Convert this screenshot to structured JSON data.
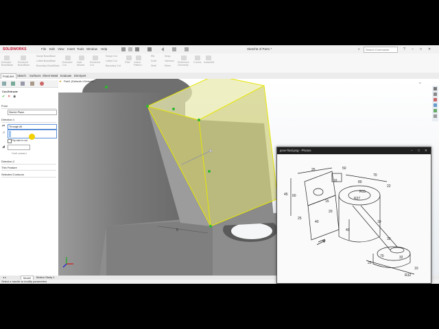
{
  "app": {
    "logo": "SOLIDWORKS",
    "menu": [
      "File",
      "Edit",
      "View",
      "Insert",
      "Tools",
      "Window",
      "Help"
    ],
    "document_title": "Sketch6 of Part1 *",
    "search_placeholder": "Search Commands"
  },
  "ribbon": {
    "groups": [
      [
        "Extruded Boss/Base",
        "Revolved Boss/Base"
      ],
      [
        "Swept Boss/Base",
        "Lofted Boss/Base",
        "Boundary Boss/Base"
      ],
      [
        "Extruded Cut",
        "Hole Wizard",
        "Revolved Cut"
      ],
      [
        "Swept Cut",
        "Lofted Cut",
        "Boundary Cut"
      ],
      [
        "Fillet",
        "Linear Pattern",
        "Rib",
        "Draft",
        "Shell"
      ],
      [
        "Wrap",
        "Intersect",
        "Mirror"
      ],
      [
        "Reference Geometry",
        "Curves",
        "Instant3D"
      ]
    ]
  },
  "tabs": [
    "Features",
    "Sketch",
    "Surfaces",
    "Sheet Metal",
    "Evaluate",
    "DimXpert"
  ],
  "active_tab": "Features",
  "property_manager": {
    "title": "Cut-Extrude",
    "from_label": "From",
    "from_value": "Sketch Plane",
    "direction1_label": "Direction 1",
    "end_condition": "Through All",
    "flip_side_label": "Flip side to cut",
    "draft_label": "Draft outward",
    "direction2_label": "Direction 2",
    "thin_feature_label": "Thin Feature",
    "selected_contours_label": "Selected Contours"
  },
  "viewport": {
    "tree_root": "Part1 (Default<<Default>..."
  },
  "bottom_tabs": [
    "Model",
    "Motion Study 1"
  ],
  "status_text": "Select a handle to modify parameters",
  "photos": {
    "title": "proe-final.png - Photos",
    "dims": [
      "60",
      "25",
      "50",
      "70",
      "16",
      "80",
      "22",
      "R27",
      "R15",
      "15",
      "25",
      "40",
      "20",
      "45",
      "10",
      "40",
      "32",
      "70",
      "32",
      "25",
      "10",
      "R32"
    ]
  },
  "colors": {
    "accent": "#c8102e",
    "cut_preview": "#d9d87a",
    "preview_edge": "#e6e600",
    "handle": "#2eb82e"
  }
}
